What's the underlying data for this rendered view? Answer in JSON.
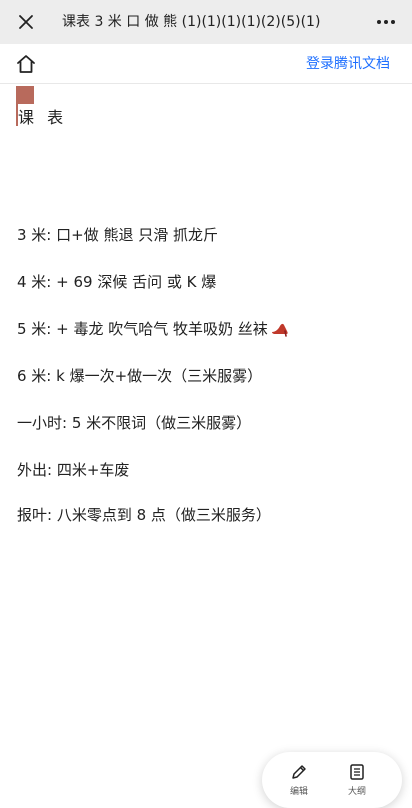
{
  "window": {
    "title": "课表 3 米 口 做 熊 (1)(1)(1)(1)(2)(5)(1)",
    "close_icon": "close-icon",
    "more_icon": "more-icon"
  },
  "toolbar": {
    "home_icon": "home-icon",
    "login_label": "登录腾讯文档"
  },
  "document": {
    "heading": "课 表",
    "lines": [
      "3 米: 口+做  熊退  只滑  抓龙斤",
      "4 米: +  69  深候  舌问    或   K 爆",
      "5 米: +  毒龙  吹气哈气  牧羊吸奶  丝袜",
      "6 米:    k 爆一次+做一次（三米服雾）",
      "一小时: 5 米不限词（做三米服雾）",
      "外出: 四米+车废",
      "报叶: 八米零点到 8 点（做三米服务）"
    ],
    "emoji_icon": "high-heel-icon"
  },
  "floating_bar": {
    "edit_label": "编辑",
    "outline_label": "大纲"
  },
  "colors": {
    "titlebar_bg": "#ededed",
    "link": "#1e6fff",
    "cursor": "#b86a5c"
  }
}
